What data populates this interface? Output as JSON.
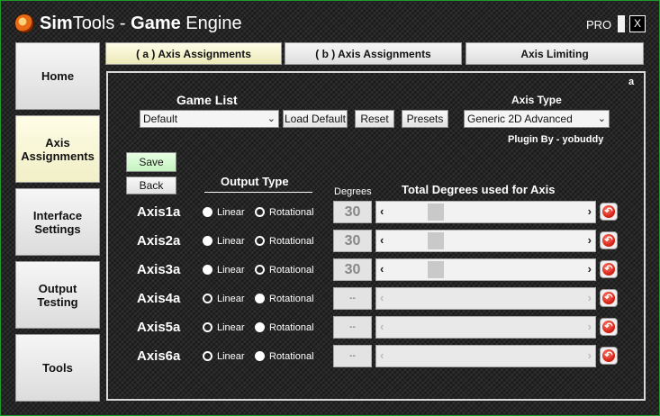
{
  "window": {
    "title_prefix": "Sim",
    "title_mid": "Tools - ",
    "title_bold": "Game",
    "title_suffix": " Engine",
    "pro_label": "PRO",
    "close_label": "X"
  },
  "sidebar": {
    "items": [
      {
        "label": "Home",
        "active": false
      },
      {
        "label": "Axis Assignments",
        "active": true
      },
      {
        "label": "Interface Settings",
        "active": false
      },
      {
        "label": "Output Testing",
        "active": false
      },
      {
        "label": "Tools",
        "active": false
      }
    ]
  },
  "tabs": [
    {
      "label": "( a ) Axis Assignments",
      "active": true
    },
    {
      "label": "( b ) Axis Assignments",
      "active": false
    },
    {
      "label": "Axis Limiting",
      "active": false
    }
  ],
  "panel": {
    "corner_label": "a",
    "game_list_label": "Game List",
    "game_select_value": "Default",
    "load_default_label": "Load Default",
    "reset_label": "Reset",
    "presets_label": "Presets",
    "axis_type_label": "Axis Type",
    "axis_type_value": "Generic 2D Advanced",
    "plugin_by": "Plugin By - yobuddy",
    "save_label": "Save",
    "back_label": "Back",
    "output_type_label": "Output Type",
    "degrees_label": "Degrees",
    "total_degrees_label": "Total Degrees used for Axis",
    "linear_label": "Linear",
    "rotational_label": "Rotational"
  },
  "axes": [
    {
      "name": "Axis1a",
      "output": "linear",
      "degrees": "30",
      "enabled": true,
      "slider_value": 0.2
    },
    {
      "name": "Axis2a",
      "output": "linear",
      "degrees": "30",
      "enabled": true,
      "slider_value": 0.2
    },
    {
      "name": "Axis3a",
      "output": "linear",
      "degrees": "30",
      "enabled": true,
      "slider_value": 0.2
    },
    {
      "name": "Axis4a",
      "output": "rotational",
      "degrees": "--",
      "enabled": false,
      "slider_value": null
    },
    {
      "name": "Axis5a",
      "output": "rotational",
      "degrees": "--",
      "enabled": false,
      "slider_value": null
    },
    {
      "name": "Axis6a",
      "output": "rotational",
      "degrees": "--",
      "enabled": false,
      "slider_value": null
    }
  ],
  "colors": {
    "accent_border": "#1d9a2a",
    "save_button": "#c5f2bf",
    "active_item": "#f1efc6",
    "reset_icon": "#d11a10"
  }
}
